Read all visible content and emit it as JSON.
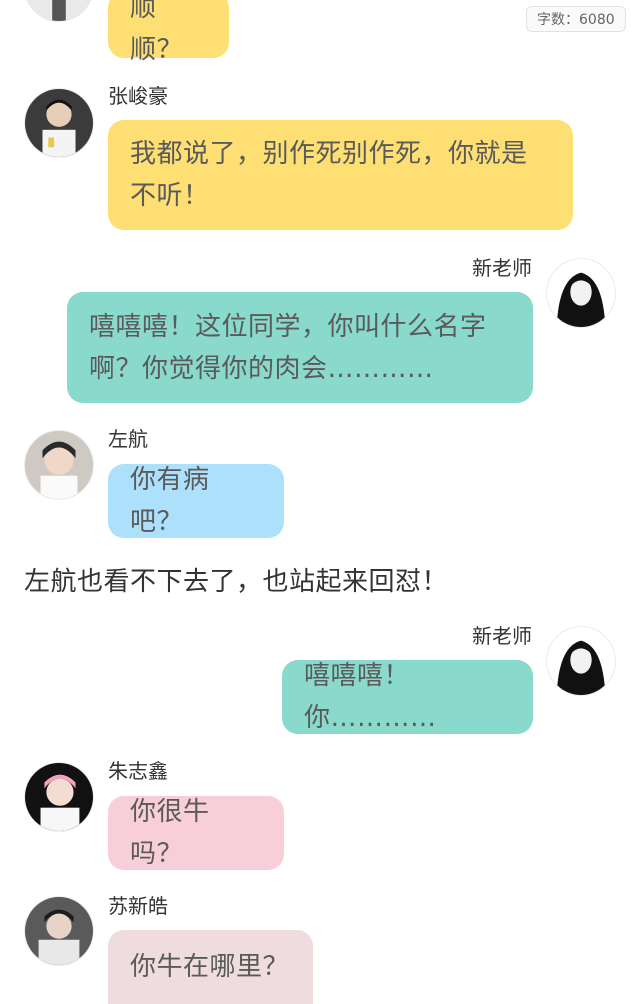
{
  "header": {
    "word_count": "字数：6080"
  },
  "messages": [
    {
      "speaker": "",
      "text": "顺顺？",
      "color": "#fedf74",
      "avatar_icon": "user-avatar-icon"
    },
    {
      "speaker": "张峻豪",
      "text": "我都说了，别作死别作死，你就是不听！",
      "color": "#fedf74",
      "avatar_icon": "user-avatar-icon"
    },
    {
      "speaker": "新老师",
      "text": "嘻嘻嘻！这位同学，你叫什么名字啊？你觉得你的肉会…………",
      "color": "#89d9cc",
      "avatar_icon": "user-avatar-icon"
    },
    {
      "speaker": "左航",
      "text": "你有病吧？",
      "color": "#ace0fb",
      "avatar_icon": "user-avatar-icon"
    },
    {
      "speaker": "新老师",
      "text": "嘻嘻嘻！你…………",
      "color": "#89d9cc",
      "avatar_icon": "user-avatar-icon"
    },
    {
      "speaker": "朱志鑫",
      "text": "你很牛吗？",
      "color": "#f8cfd8",
      "avatar_icon": "user-avatar-icon"
    },
    {
      "speaker": "苏新皓",
      "text": "你牛在哪里？",
      "color": "#efdcde",
      "avatar_icon": "user-avatar-icon"
    }
  ],
  "narration": {
    "text": "左航也看不下去了，也站起来回怼！"
  }
}
